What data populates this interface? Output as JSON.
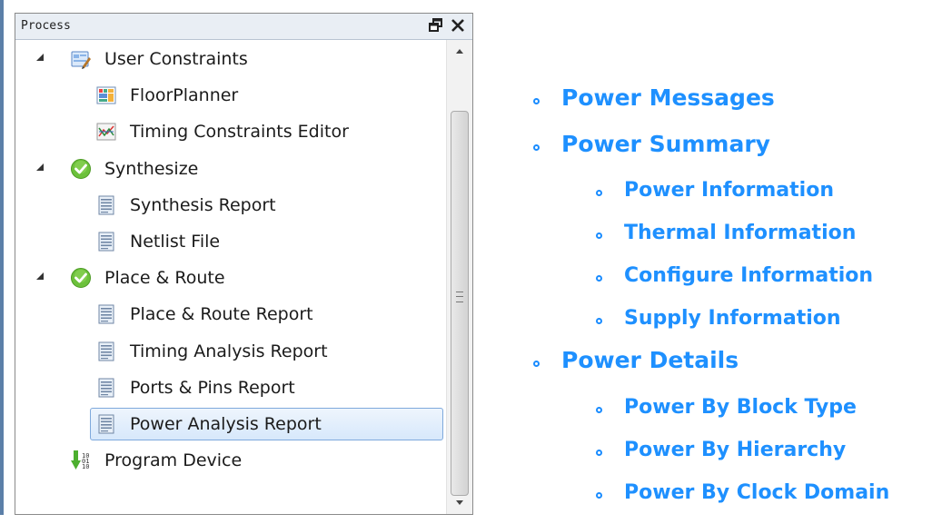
{
  "process_panel": {
    "title": "Process",
    "restore_glyph": "🗗",
    "close_glyph": "✕",
    "tree": [
      {
        "label": "User Constraints",
        "icon": "constraints-icon",
        "level": 0,
        "expanded": true
      },
      {
        "label": "FloorPlanner",
        "icon": "floorplanner-icon",
        "level": 1
      },
      {
        "label": "Timing Constraints Editor",
        "icon": "timing-editor-icon",
        "level": 1
      },
      {
        "label": "Synthesize",
        "icon": "success-check-icon",
        "level": 0,
        "expanded": true
      },
      {
        "label": "Synthesis Report",
        "icon": "report-icon",
        "level": 1
      },
      {
        "label": "Netlist File",
        "icon": "report-icon",
        "level": 1
      },
      {
        "label": "Place & Route",
        "icon": "success-check-icon",
        "level": 0,
        "expanded": true
      },
      {
        "label": "Place & Route Report",
        "icon": "report-icon",
        "level": 1
      },
      {
        "label": "Timing Analysis Report",
        "icon": "report-icon",
        "level": 1
      },
      {
        "label": "Ports & Pins Report",
        "icon": "report-icon",
        "level": 1
      },
      {
        "label": "Power Analysis Report",
        "icon": "report-icon",
        "level": 1,
        "selected": true
      },
      {
        "label": "Program Device",
        "icon": "program-device-icon",
        "level": 0
      }
    ]
  },
  "report_links": [
    {
      "label": "Power Messages",
      "level": 1
    },
    {
      "label": "Power Summary",
      "level": 1
    },
    {
      "label": "Power Information",
      "level": 2
    },
    {
      "label": "Thermal Information",
      "level": 2
    },
    {
      "label": "Configure Information",
      "level": 2
    },
    {
      "label": "Supply Information",
      "level": 2
    },
    {
      "label": "Power Details",
      "level": 1
    },
    {
      "label": "Power By Block Type",
      "level": 2
    },
    {
      "label": "Power By Hierarchy",
      "level": 2
    },
    {
      "label": "Power By Clock Domain",
      "level": 2
    }
  ],
  "colors": {
    "link": "#1e90ff",
    "success": "#6cc13b",
    "selection": "#d7e8fb"
  }
}
